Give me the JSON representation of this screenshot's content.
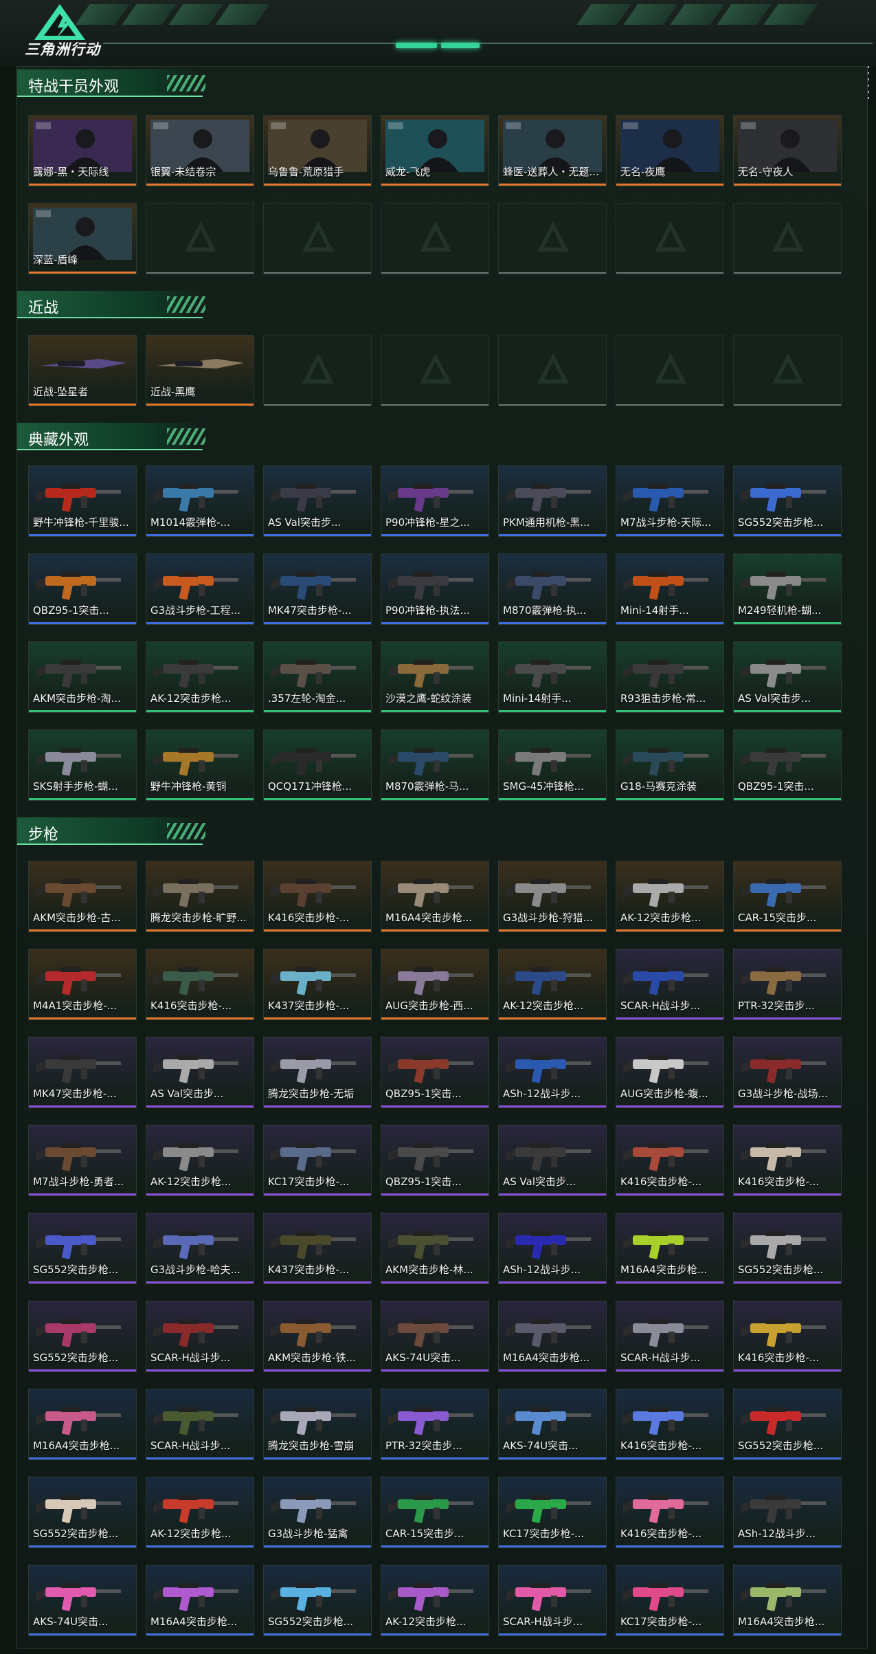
{
  "header": {
    "brand": "三角洲行动",
    "logo_icon": "delta-logo-icon",
    "colors": {
      "accent": "#35d39a",
      "bg": "#0e1612"
    }
  },
  "sections": {
    "operators": {
      "title": "特战干员外观"
    },
    "melee": {
      "title": "近战"
    },
    "collection": {
      "title": "典藏外观"
    },
    "rifles": {
      "title": "步枪"
    }
  },
  "rarity_colors": {
    "orange": "#e2772c",
    "purple": "#8a4fd8",
    "blue": "#3e6de0",
    "green": "#2fc07a"
  },
  "operators": [
    {
      "label": "露娜-黑・天际线",
      "rarity": "orange",
      "tone": "#3a2a52"
    },
    {
      "label": "银翼-未结卷宗",
      "rarity": "orange",
      "tone": "#3b4650"
    },
    {
      "label": "乌鲁鲁-荒原猎手",
      "rarity": "orange",
      "tone": "#4a4030"
    },
    {
      "label": "威龙-飞虎",
      "rarity": "orange",
      "tone": "#1e5058"
    },
    {
      "label": "蜂医-送葬人・无题...",
      "rarity": "orange",
      "tone": "#2a3e48"
    },
    {
      "label": "无名-夜鹰",
      "rarity": "orange",
      "tone": "#1c2e48"
    },
    {
      "label": "无名-守夜人",
      "rarity": "orange",
      "tone": "#2e3034"
    },
    {
      "label": "深蓝-盾峰",
      "rarity": "orange",
      "tone": "#2c4048"
    }
  ],
  "melee": [
    {
      "label": "近战-坠星者",
      "rarity": "orange",
      "tone": "#5a4a8a"
    },
    {
      "label": "近战-黑鹰",
      "rarity": "orange",
      "tone": "#8a7a60"
    }
  ],
  "collection": [
    {
      "label": "野牛冲锋枪-千里骏...",
      "rarity": "blue",
      "tone": "#b52a1c"
    },
    {
      "label": "M1014霰弹枪-...",
      "rarity": "blue",
      "tone": "#3a7aa8"
    },
    {
      "label": "AS Val突击步...",
      "rarity": "blue",
      "tone": "#3a3a48"
    },
    {
      "label": "P90冲锋枪-星之...",
      "rarity": "blue",
      "tone": "#6a3a8a"
    },
    {
      "label": "PKM通用机枪-黑...",
      "rarity": "blue",
      "tone": "#4a4a58"
    },
    {
      "label": "M7战斗步枪-天际...",
      "rarity": "blue",
      "tone": "#2a5ab0"
    },
    {
      "label": "SG552突击步枪...",
      "rarity": "blue",
      "tone": "#3a6ad0"
    },
    {
      "label": "QBZ95-1突击...",
      "rarity": "blue",
      "tone": "#c06a20"
    },
    {
      "label": "G3战斗步枪-工程...",
      "rarity": "blue",
      "tone": "#c85a20"
    },
    {
      "label": "MK47突击步枪-...",
      "rarity": "blue",
      "tone": "#2a4a78"
    },
    {
      "label": "P90冲锋枪-执法...",
      "rarity": "blue",
      "tone": "#3a3a40"
    },
    {
      "label": "M870霰弹枪-执...",
      "rarity": "blue",
      "tone": "#3a4a68"
    },
    {
      "label": "Mini-14射手...",
      "rarity": "blue",
      "tone": "#c05018"
    },
    {
      "label": "M249轻机枪-蝴...",
      "rarity": "green",
      "tone": "#8a8a8a"
    },
    {
      "label": "AKM突击步枪-淘...",
      "rarity": "green",
      "tone": "#3a3a3a"
    },
    {
      "label": "AK-12突击步枪...",
      "rarity": "green",
      "tone": "#3a3a3a"
    },
    {
      "label": ".357左轮-淘金...",
      "rarity": "green",
      "tone": "#5a5048"
    },
    {
      "label": "沙漠之鹰-蛇纹涂装",
      "rarity": "green",
      "tone": "#8a6a3a"
    },
    {
      "label": "Mini-14射手...",
      "rarity": "green",
      "tone": "#4a4a4a"
    },
    {
      "label": "R93狙击步枪-常...",
      "rarity": "green",
      "tone": "#3a3a3a"
    },
    {
      "label": "AS Val突击步...",
      "rarity": "green",
      "tone": "#8a8a8a"
    },
    {
      "label": "SKS射手步枪-蝴...",
      "rarity": "green",
      "tone": "#8a8a9a"
    },
    {
      "label": "野牛冲锋枪-黄铜",
      "rarity": "green",
      "tone": "#a8782a"
    },
    {
      "label": "QCQ171冲锋枪...",
      "rarity": "green",
      "tone": "#2a2a2a"
    },
    {
      "label": "M870霰弹枪-马...",
      "rarity": "green",
      "tone": "#2a4a6a"
    },
    {
      "label": "SMG-45冲锋枪...",
      "rarity": "green",
      "tone": "#7a7a7a"
    },
    {
      "label": "G18-马赛克涂装",
      "rarity": "green",
      "tone": "#2a4a5a"
    },
    {
      "label": "QBZ95-1突击...",
      "rarity": "green",
      "tone": "#3a3a3a"
    }
  ],
  "rifles": [
    {
      "label": "AKM突击步枪-古...",
      "rarity": "orange",
      "tone": "#6a4a30"
    },
    {
      "label": "腾龙突击步枪-旷野...",
      "rarity": "orange",
      "tone": "#7a7060"
    },
    {
      "label": "K416突击步枪-...",
      "rarity": "orange",
      "tone": "#5a4030"
    },
    {
      "label": "M16A4突击步枪...",
      "rarity": "orange",
      "tone": "#9a8a78"
    },
    {
      "label": "G3战斗步枪-狩猎...",
      "rarity": "orange",
      "tone": "#8a8a8a"
    },
    {
      "label": "AK-12突击步枪...",
      "rarity": "orange",
      "tone": "#aaaaaa"
    },
    {
      "label": "CAR-15突击步...",
      "rarity": "orange",
      "tone": "#3a6ab0"
    },
    {
      "label": "M4A1突击步枪-...",
      "rarity": "orange",
      "tone": "#b52a2a"
    },
    {
      "label": "K416突击步枪-...",
      "rarity": "orange",
      "tone": "#3a5a4a"
    },
    {
      "label": "K437突击步枪-...",
      "rarity": "orange",
      "tone": "#6ab0c8"
    },
    {
      "label": "AUG突击步枪-西...",
      "rarity": "orange",
      "tone": "#8a7a9a"
    },
    {
      "label": "AK-12突击步枪...",
      "rarity": "orange",
      "tone": "#2a4a8a"
    },
    {
      "label": "SCAR-H战斗步...",
      "rarity": "purple",
      "tone": "#2a4aa8"
    },
    {
      "label": "PTR-32突击步...",
      "rarity": "purple",
      "tone": "#8a6a40"
    },
    {
      "label": "MK47突击步枪-...",
      "rarity": "purple",
      "tone": "#3a3a3a"
    },
    {
      "label": "AS Val突击步...",
      "rarity": "purple",
      "tone": "#aaaaaa"
    },
    {
      "label": "腾龙突击步枪-无垢",
      "rarity": "purple",
      "tone": "#9a9aa8"
    },
    {
      "label": "QBZ95-1突击...",
      "rarity": "purple",
      "tone": "#8a3a2a"
    },
    {
      "label": "ASh-12战斗步...",
      "rarity": "purple",
      "tone": "#2a5ab0"
    },
    {
      "label": "AUG突击步枪-蝮...",
      "rarity": "purple",
      "tone": "#c8c8c8"
    },
    {
      "label": "G3战斗步枪-战场...",
      "rarity": "purple",
      "tone": "#8a2a2a"
    },
    {
      "label": "M7战斗步枪-勇者...",
      "rarity": "purple",
      "tone": "#6a4a30"
    },
    {
      "label": "AK-12突击步枪...",
      "rarity": "purple",
      "tone": "#8a8a8a"
    },
    {
      "label": "KC17突击步枪-...",
      "rarity": "purple",
      "tone": "#5a6a8a"
    },
    {
      "label": "QBZ95-1突击...",
      "rarity": "purple",
      "tone": "#4a4a4a"
    },
    {
      "label": "AS Val突击步...",
      "rarity": "purple",
      "tone": "#3a3a3a"
    },
    {
      "label": "K416突击步枪-...",
      "rarity": "purple",
      "tone": "#a84a3a"
    },
    {
      "label": "K416突击步枪-...",
      "rarity": "purple",
      "tone": "#c8b8a8"
    },
    {
      "label": "SG552突击步枪...",
      "rarity": "purple",
      "tone": "#4a5ac8"
    },
    {
      "label": "G3战斗步枪-哈夫...",
      "rarity": "purple",
      "tone": "#5a6ab8"
    },
    {
      "label": "K437突击步枪-...",
      "rarity": "purple",
      "tone": "#4a4a2a"
    },
    {
      "label": "AKM突击步枪-林...",
      "rarity": "purple",
      "tone": "#4a5030"
    },
    {
      "label": "ASh-12战斗步...",
      "rarity": "purple",
      "tone": "#2a2ab0"
    },
    {
      "label": "M16A4突击步枪...",
      "rarity": "purple",
      "tone": "#a8d02a"
    },
    {
      "label": "SG552突击步枪...",
      "rarity": "purple",
      "tone": "#aaaaaa"
    },
    {
      "label": "SG552突击步枪...",
      "rarity": "purple",
      "tone": "#a83a6a"
    },
    {
      "label": "SCAR-H战斗步...",
      "rarity": "purple",
      "tone": "#8a2a2a"
    },
    {
      "label": "AKM突击步枪-铁...",
      "rarity": "purple",
      "tone": "#8a5a30"
    },
    {
      "label": "AKS-74U突击...",
      "rarity": "purple",
      "tone": "#6a4a3a"
    },
    {
      "label": "M16A4突击步枪...",
      "rarity": "purple",
      "tone": "#5a5a6a"
    },
    {
      "label": "SCAR-H战斗步...",
      "rarity": "purple",
      "tone": "#8a8a98"
    },
    {
      "label": "K416突击步枪-...",
      "rarity": "purple",
      "tone": "#c8a030"
    },
    {
      "label": "M16A4突击步枪...",
      "rarity": "blue",
      "tone": "#c85a8a"
    },
    {
      "label": "SCAR-H战斗步...",
      "rarity": "blue",
      "tone": "#4a5a30"
    },
    {
      "label": "腾龙突击步枪-雪崩",
      "rarity": "blue",
      "tone": "#a8a8b8"
    },
    {
      "label": "PTR-32突击步...",
      "rarity": "blue",
      "tone": "#8a5ad0"
    },
    {
      "label": "AKS-74U突击...",
      "rarity": "blue",
      "tone": "#5a8ad0"
    },
    {
      "label": "K416突击步枪-...",
      "rarity": "blue",
      "tone": "#5a7ae0"
    },
    {
      "label": "SG552突击步枪...",
      "rarity": "blue",
      "tone": "#c82a2a"
    },
    {
      "label": "SG552突击步枪...",
      "rarity": "blue",
      "tone": "#d8c8b8"
    },
    {
      "label": "AK-12突击步枪...",
      "rarity": "blue",
      "tone": "#c83a2a"
    },
    {
      "label": "G3战斗步枪-猛禽",
      "rarity": "blue",
      "tone": "#8a9ab8"
    },
    {
      "label": "CAR-15突击步...",
      "rarity": "blue",
      "tone": "#2a9a4a"
    },
    {
      "label": "KC17突击步枪-...",
      "rarity": "blue",
      "tone": "#2aa84a"
    },
    {
      "label": "K416突击步枪-...",
      "rarity": "blue",
      "tone": "#e06a9a"
    },
    {
      "label": "ASh-12战斗步...",
      "rarity": "blue",
      "tone": "#3a3a3a"
    },
    {
      "label": "AKS-74U突击...",
      "rarity": "blue",
      "tone": "#e05ab0"
    },
    {
      "label": "M16A4突击步枪...",
      "rarity": "blue",
      "tone": "#b05ad0"
    },
    {
      "label": "SG552突击步枪...",
      "rarity": "blue",
      "tone": "#5ab0e0"
    },
    {
      "label": "AK-12突击步枪...",
      "rarity": "blue",
      "tone": "#a85ac8"
    },
    {
      "label": "SCAR-H战斗步...",
      "rarity": "blue",
      "tone": "#e05aa8"
    },
    {
      "label": "KC17突击步枪-...",
      "rarity": "blue",
      "tone": "#e04a8a"
    },
    {
      "label": "M16A4突击步枪...",
      "rarity": "blue",
      "tone": "#9ab86a"
    }
  ]
}
